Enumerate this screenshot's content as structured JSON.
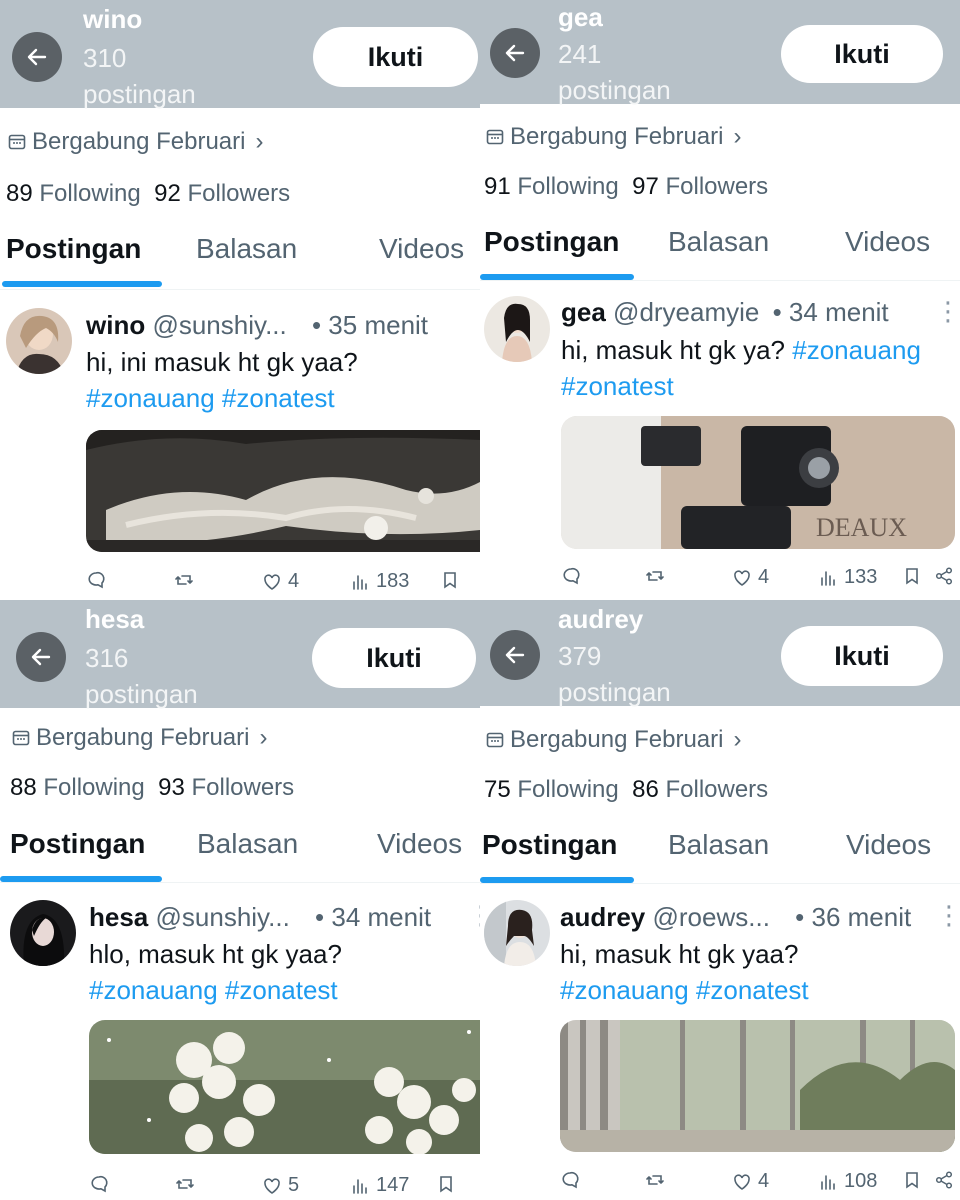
{
  "panels": [
    {
      "header": {
        "name": "wino",
        "count": "310 postingan",
        "follow_label": "Ikuti"
      },
      "joined": "Bergabung Februari",
      "stats": {
        "following_count": "89",
        "following_label": "Following",
        "followers_count": "92",
        "followers_label": "Followers"
      },
      "tabs": [
        "Postingan",
        "Balasan",
        "Videos"
      ],
      "post": {
        "name": "wino",
        "handle": "@sunshiy...",
        "time": "• 35 menit",
        "text": "hi, ini masuk ht gk yaa?",
        "tags": "#zonauang #zonatest",
        "actions": {
          "reply": "",
          "repost": "",
          "likes": "4",
          "views": "183"
        }
      }
    },
    {
      "header": {
        "name": "gea",
        "count": "241 postingan",
        "follow_label": "Ikuti"
      },
      "joined": "Bergabung Februari",
      "stats": {
        "following_count": "91",
        "following_label": "Following",
        "followers_count": "97",
        "followers_label": "Followers"
      },
      "tabs": [
        "Postingan",
        "Balasan",
        "Videos"
      ],
      "post": {
        "name": "gea",
        "handle": "@dryeamyie",
        "time": "• 34 menit",
        "text": "hi, masuk ht gk ya?",
        "tags": "#zonauang #zonatest",
        "actions": {
          "reply": "",
          "repost": "",
          "likes": "4",
          "views": "133"
        }
      }
    },
    {
      "header": {
        "name": "hesa",
        "count": "316 postingan",
        "follow_label": "Ikuti"
      },
      "joined": "Bergabung Februari",
      "stats": {
        "following_count": "88",
        "following_label": "Following",
        "followers_count": "93",
        "followers_label": "Followers"
      },
      "tabs": [
        "Postingan",
        "Balasan",
        "Videos"
      ],
      "post": {
        "name": "hesa",
        "handle": "@sunshiy...",
        "time": "• 34 menit",
        "text": "hlo, masuk ht gk yaa?",
        "tags": "#zonauang #zonatest",
        "actions": {
          "reply": "",
          "repost": "",
          "likes": "5",
          "views": "147"
        }
      }
    },
    {
      "header": {
        "name": "audrey",
        "count": "379 postingan",
        "follow_label": "Ikuti"
      },
      "joined": "Bergabung Februari",
      "stats": {
        "following_count": "75",
        "following_label": "Following",
        "followers_count": "86",
        "followers_label": "Followers"
      },
      "tabs": [
        "Postingan",
        "Balasan",
        "Videos"
      ],
      "post": {
        "name": "audrey",
        "handle": "@roews...",
        "time": "• 36 menit",
        "text": "hi, masuk ht gk yaa?",
        "tags": "#zonauang #zonatest",
        "actions": {
          "reply": "",
          "repost": "",
          "likes": "4",
          "views": "108"
        }
      }
    }
  ],
  "colors": {
    "header_bg": "#b7c1c8",
    "accent": "#1d9bf0",
    "muted": "#536471"
  }
}
